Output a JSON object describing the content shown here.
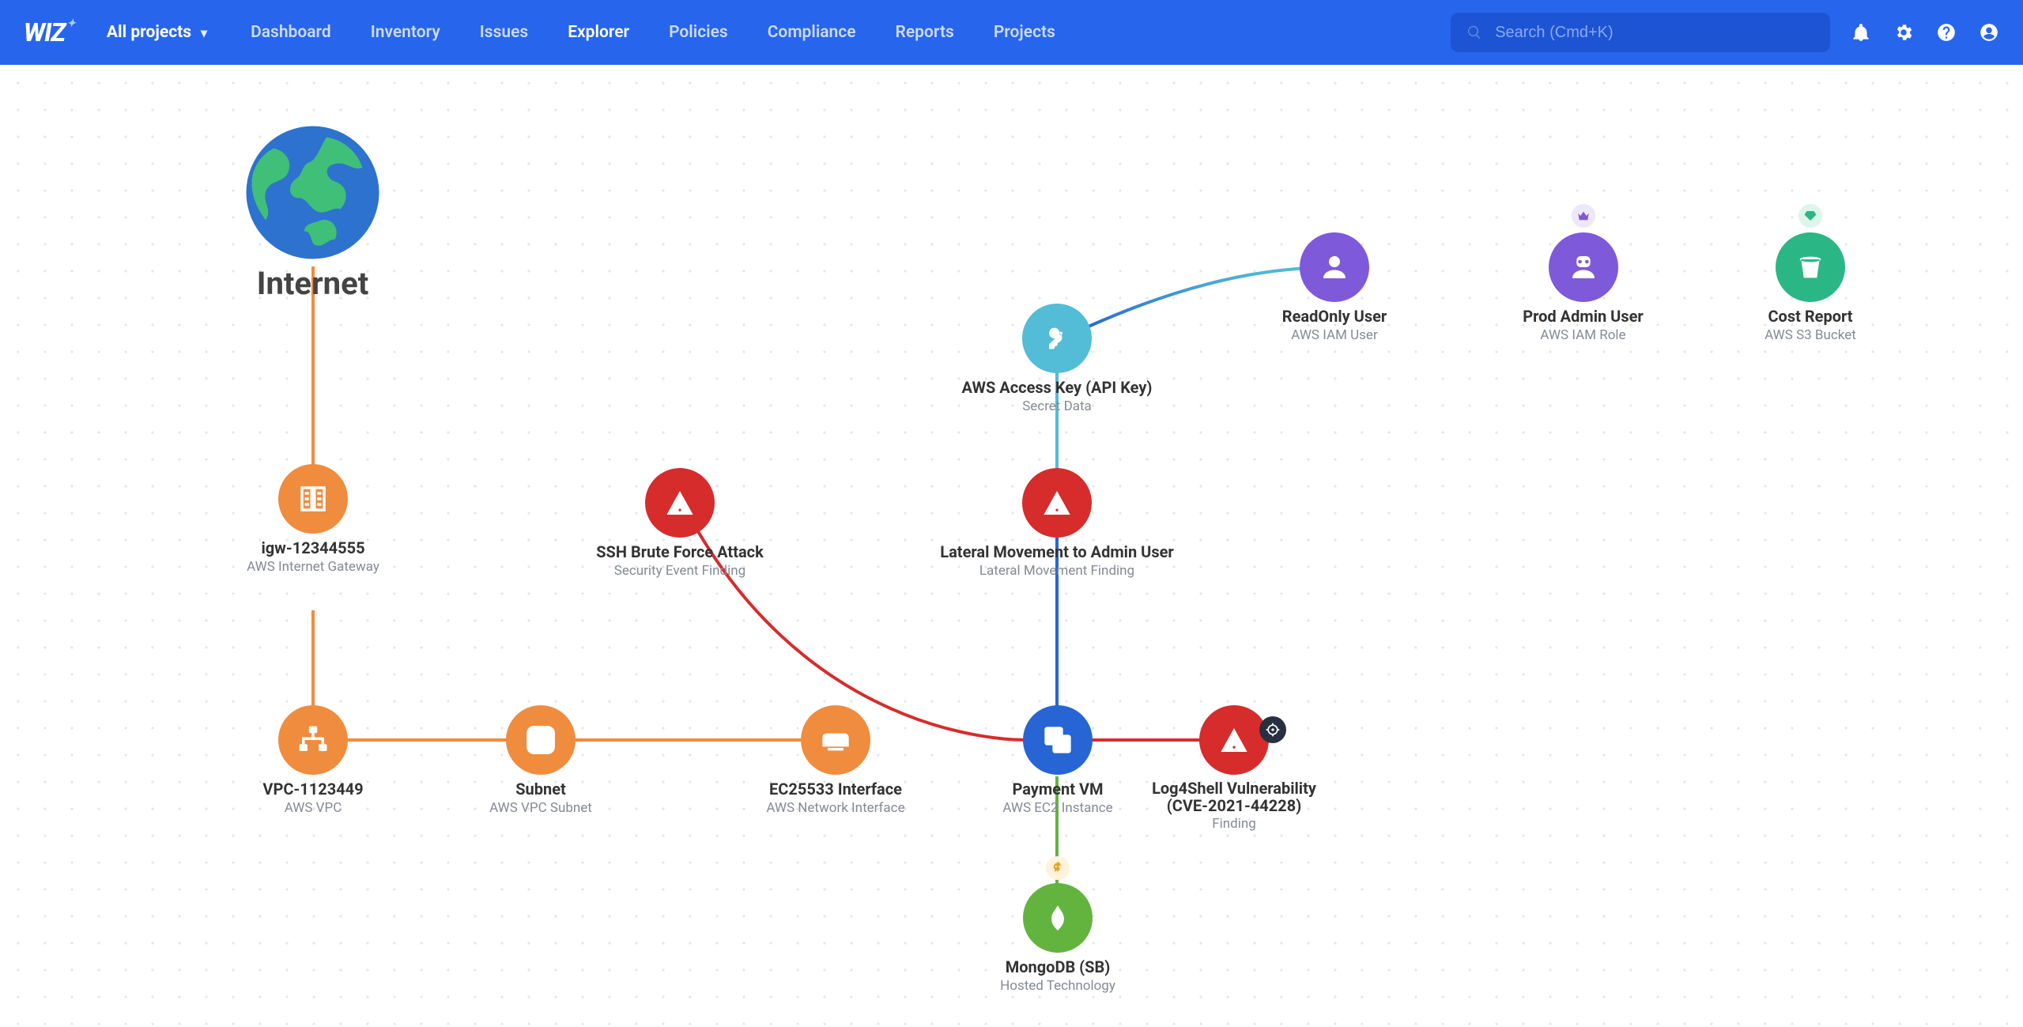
{
  "app": {
    "name": "WIZ"
  },
  "projectSelector": {
    "label": "All projects"
  },
  "nav": {
    "items": [
      {
        "label": "Dashboard",
        "active": false
      },
      {
        "label": "Inventory",
        "active": false
      },
      {
        "label": "Issues",
        "active": false
      },
      {
        "label": "Explorer",
        "active": true
      },
      {
        "label": "Policies",
        "active": false
      },
      {
        "label": "Compliance",
        "active": false
      },
      {
        "label": "Reports",
        "active": false
      },
      {
        "label": "Projects",
        "active": false
      }
    ]
  },
  "search": {
    "placeholder": "Search (Cmd+K)",
    "value": ""
  },
  "iconbar": {
    "bell": "notifications-icon",
    "gear": "settings-icon",
    "help": "help-icon",
    "user": "account-icon"
  },
  "graph": {
    "nodes": {
      "internet": {
        "title": "Internet"
      },
      "igw": {
        "title": "igw-12344555",
        "subtitle": "AWS Internet Gateway"
      },
      "vpc": {
        "title": "VPC-1123449",
        "subtitle": "AWS VPC"
      },
      "subnet": {
        "title": "Subnet",
        "subtitle": "AWS VPC Subnet"
      },
      "eni": {
        "title": "EC25533 Interface",
        "subtitle": "AWS Network Interface"
      },
      "paymentvm": {
        "title": "Payment VM",
        "subtitle": "AWS EC2 Instance"
      },
      "ssh": {
        "title": "SSH Brute Force Attack",
        "subtitle": "Security Event Finding"
      },
      "lateral": {
        "title": "Lateral Movement to Admin User",
        "subtitle": "Lateral Movement Finding"
      },
      "accesskey": {
        "title": "AWS Access Key (API Key)",
        "subtitle": "Secret Data"
      },
      "rouser": {
        "title": "ReadOnly User",
        "subtitle": "AWS IAM User"
      },
      "adminrole": {
        "title": "Prod Admin User",
        "subtitle": "AWS IAM Role",
        "badge": "crown"
      },
      "costrpt": {
        "title": "Cost Report",
        "subtitle": "AWS S3 Bucket",
        "badge": "gem"
      },
      "log4shell": {
        "title": "Log4Shell Vulnerability (CVE-2021-44228)",
        "subtitle": "Finding",
        "sidebadge": "crosshair"
      },
      "mongo": {
        "title": "MongoDB (SB)",
        "subtitle": "Hosted Technology",
        "topbadge": "skull"
      }
    }
  }
}
